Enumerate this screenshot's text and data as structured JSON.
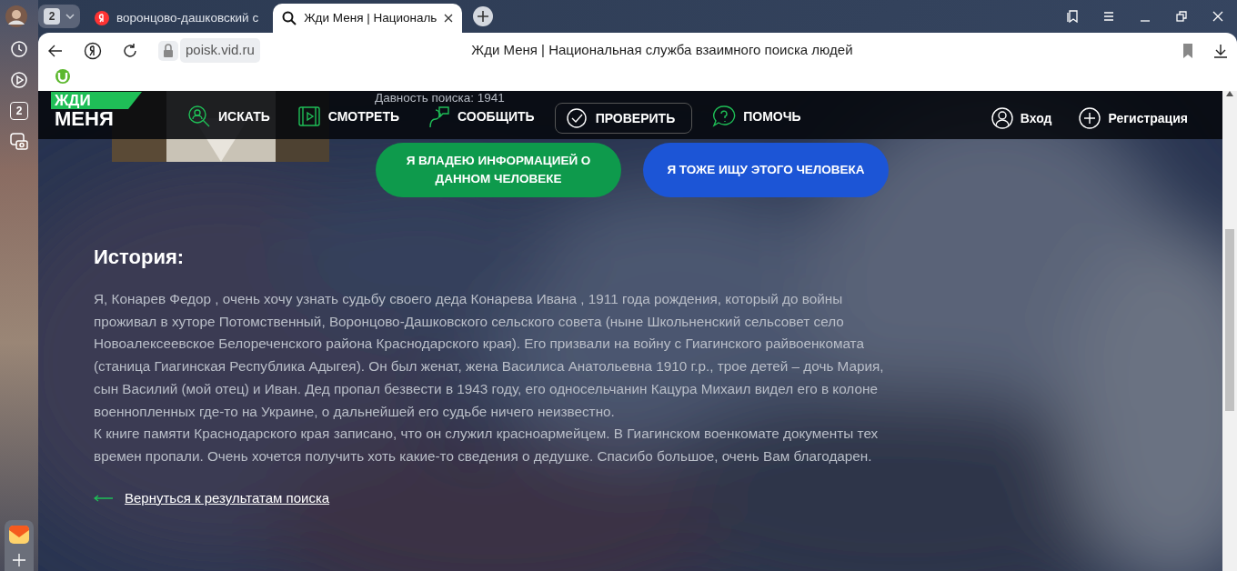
{
  "browser": {
    "tab_count": "2",
    "tabs": [
      {
        "label": "воронцово-дашковский с",
        "selected": false
      },
      {
        "label": "Жди Меня | Националь",
        "selected": true
      }
    ],
    "address": "poisk.vid.ru",
    "page_title": "Жди Меня | Национальная служба взаимного поиска людей",
    "sidebar_badge": "2"
  },
  "site": {
    "logo": [
      "ЖДИ",
      "МЕНЯ"
    ],
    "nav": [
      {
        "label": "ИСКАТЬ",
        "outlined": false
      },
      {
        "label": "СМОТРЕТЬ",
        "outlined": false
      },
      {
        "label": "СООБЩИТЬ",
        "outlined": false
      },
      {
        "label": "ПРОВЕРИТЬ",
        "outlined": true
      },
      {
        "label": "ПОМОЧЬ",
        "outlined": false
      }
    ],
    "login": "Вход",
    "register": "Регистрация"
  },
  "search_age": "Давность поиска: 1941",
  "actions": [
    {
      "label": "Я ВЛАДЕЮ ИНФОРМАЦИЕЙ О ДАННОМ ЧЕЛОВЕКЕ",
      "kind": "info"
    },
    {
      "label": "Я ТОЖЕ ИЩУ ЭТОГО ЧЕЛОВЕКА",
      "kind": "search"
    }
  ],
  "story": {
    "heading": "История:",
    "paragraphs": [
      "Я, Конарев Федор , очень хочу узнать судьбу своего деда Конарева Ивана , 1911 года рождения, который до войны проживал в хуторе Потомственный, Воронцово-Дашковского сельского совета (ныне Школьненский сельсовет село Новоалексеевское Белореченского района Краснодарского края). Его призвали на войну с Гиагинского райвоенкомата (станица Гиагинская Республика Адыгея). Он был женат, жена Василиса Анатольевна 1910 г.р., трое детей – дочь Мария, сын Василий (мой отец) и Иван. Дед пропал безвести в 1943 году, его односельчанин Кацура Михаил видел его в колоне военнопленных где-то на Украине, о дальнейшей его судьбе ничего неизвестно.",
      "К книге памяти Краснодарского края записано, что он служил красноармейцем. В Гиагинском военкомате документы тех времен пропали. Очень хочется получить хоть какие-то сведения о дедушке. Спасибо большое, очень Вам благодарен."
    ]
  },
  "back_link": "Вернуться к результатам поиска"
}
